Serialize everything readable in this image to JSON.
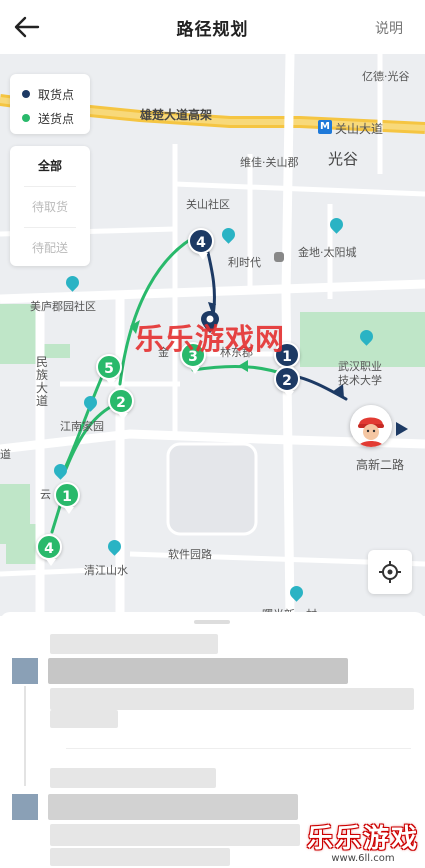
{
  "header": {
    "title": "路径规划",
    "help_label": "说明"
  },
  "legend": {
    "pickup_label": "取货点",
    "delivery_label": "送货点",
    "pickup_color": "#1d3a64",
    "delivery_color": "#29b96b"
  },
  "filter": {
    "options": [
      "全部",
      "待取货",
      "待配送"
    ],
    "selected": "全部"
  },
  "map": {
    "labels": {
      "yiyao": "亿德·光谷",
      "road_main": "雄楚大道高架",
      "metro": "关山大道",
      "weijia": "维佳·关山郡",
      "guanggu": "光谷",
      "guanshan": "关山社区",
      "jindi": "金地·太阳城",
      "time": "利时代",
      "meilu": "美庐郡园社区",
      "college": "武汉职业\n技术大学",
      "jinqiao": "金",
      "linhuang": "林东郡",
      "minzu": "民\n族\n大\n道",
      "jiangnan": "江南家园",
      "road_gaoxin": "高新二路",
      "yun": "云",
      "software": "软件园路",
      "qingjiang": "清江山水",
      "dao": "道",
      "bottom_cut": "曙光新一村"
    },
    "markers": [
      {
        "type": "pickup",
        "label": "4"
      },
      {
        "type": "pickup",
        "label": "1"
      },
      {
        "type": "pickup",
        "label": "2"
      },
      {
        "type": "delivery",
        "label": "3"
      },
      {
        "type": "delivery",
        "label": "5"
      },
      {
        "type": "delivery",
        "label": "2"
      },
      {
        "type": "delivery",
        "label": "1"
      },
      {
        "type": "delivery",
        "label": "4"
      }
    ],
    "icons": {
      "rider": "rider-avatar-icon",
      "locate": "locate-icon"
    },
    "watermark": "乐乐游戏网"
  },
  "brand": {
    "name": "乐乐游戏",
    "url": "www.6ll.com"
  }
}
